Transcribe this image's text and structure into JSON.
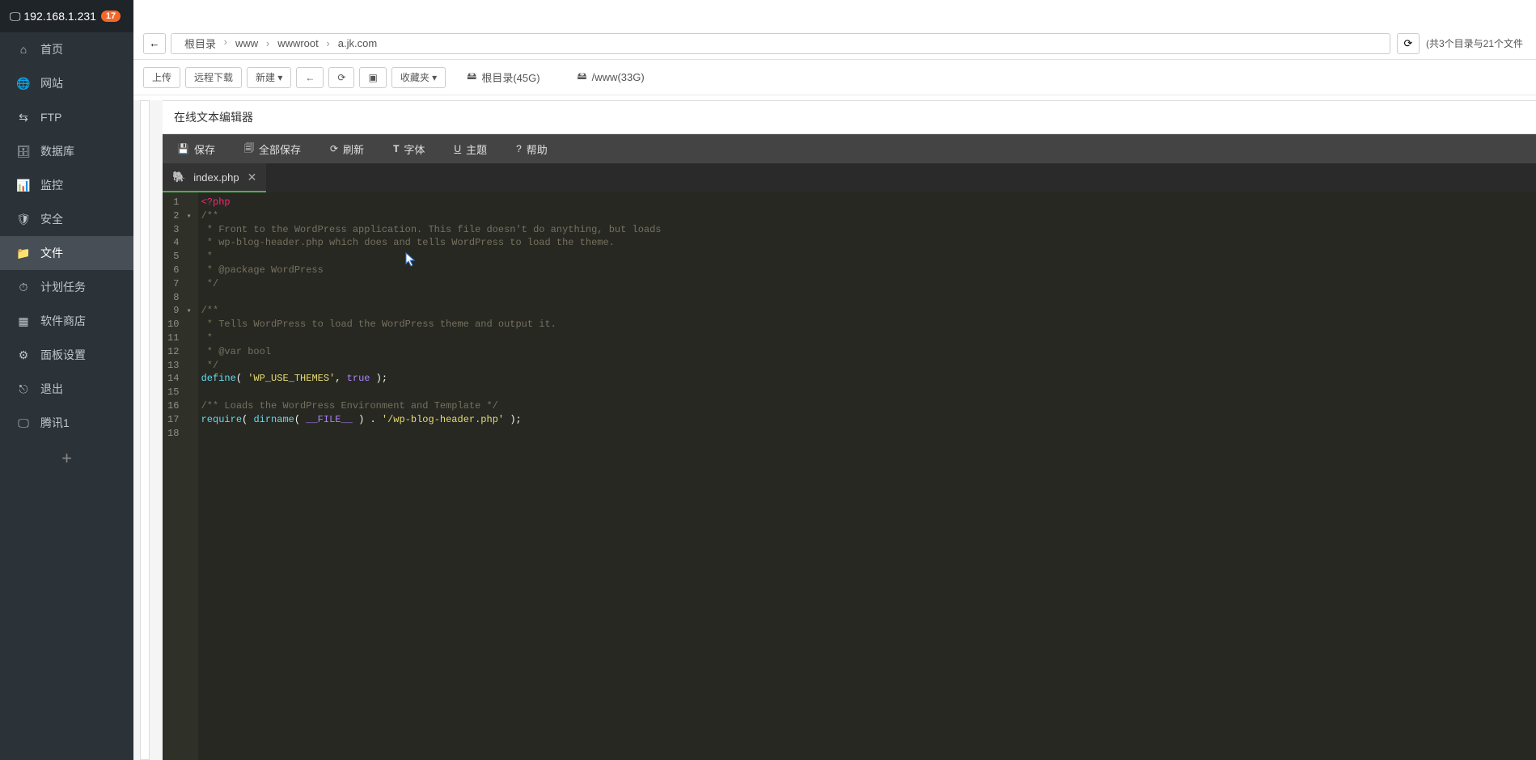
{
  "server": {
    "ip": "192.168.1.231",
    "badge": "17"
  },
  "sidebar": {
    "items": [
      {
        "label": "首页",
        "icon": "home"
      },
      {
        "label": "网站",
        "icon": "globe"
      },
      {
        "label": "FTP",
        "icon": "ftp"
      },
      {
        "label": "数据库",
        "icon": "db"
      },
      {
        "label": "监控",
        "icon": "monitor"
      },
      {
        "label": "安全",
        "icon": "shield"
      },
      {
        "label": "文件",
        "icon": "folder"
      },
      {
        "label": "计划任务",
        "icon": "cron"
      },
      {
        "label": "软件商店",
        "icon": "store"
      },
      {
        "label": "面板设置",
        "icon": "settings"
      },
      {
        "label": "退出",
        "icon": "logout"
      }
    ],
    "extra": {
      "label": "腾讯1"
    }
  },
  "breadcrumb": {
    "items": [
      "根目录",
      "www",
      "wwwroot",
      "a.jk.com"
    ],
    "count_text": "(共3个目录与21个文件"
  },
  "toolbar": {
    "upload": "上传",
    "remote_download": "远程下载",
    "new": "新建",
    "favorites": "收藏夹",
    "disks": [
      {
        "label": "根目录(45G)"
      },
      {
        "label": "/www(33G)"
      }
    ]
  },
  "editor": {
    "title": "在线文本编辑器",
    "buttons": {
      "save": "保存",
      "save_all": "全部保存",
      "refresh": "刷新",
      "font": "字体",
      "theme": "主题",
      "help": "帮助"
    },
    "tab": {
      "filename": "index.php"
    },
    "code_lines": [
      {
        "n": "1",
        "fold": "",
        "html": "<span class='c-tag'>&lt;?php</span>"
      },
      {
        "n": "2",
        "fold": "▾",
        "html": "<span class='c-comment'>/**</span>"
      },
      {
        "n": "3",
        "fold": "",
        "html": "<span class='c-comment'> * Front to the WordPress application. This file doesn't do anything, but loads</span>"
      },
      {
        "n": "4",
        "fold": "",
        "html": "<span class='c-comment'> * wp-blog-header.php which does and tells WordPress to load the theme.</span>"
      },
      {
        "n": "5",
        "fold": "",
        "html": "<span class='c-comment'> *</span>"
      },
      {
        "n": "6",
        "fold": "",
        "html": "<span class='c-comment'> * @package WordPress</span>"
      },
      {
        "n": "7",
        "fold": "",
        "html": "<span class='c-comment'> */</span>"
      },
      {
        "n": "8",
        "fold": "",
        "html": ""
      },
      {
        "n": "9",
        "fold": "▾",
        "html": "<span class='c-comment'>/**</span>"
      },
      {
        "n": "10",
        "fold": "",
        "html": "<span class='c-comment'> * Tells WordPress to load the WordPress theme and output it.</span>"
      },
      {
        "n": "11",
        "fold": "",
        "html": "<span class='c-comment'> *</span>"
      },
      {
        "n": "12",
        "fold": "",
        "html": "<span class='c-comment'> * @var bool</span>"
      },
      {
        "n": "13",
        "fold": "",
        "html": "<span class='c-comment'> */</span>"
      },
      {
        "n": "14",
        "fold": "",
        "html": "<span class='c-builtin'>define</span>( <span class='c-string'>'WP_USE_THEMES'</span>, <span class='c-const'>true</span> );"
      },
      {
        "n": "15",
        "fold": "",
        "html": ""
      },
      {
        "n": "16",
        "fold": "",
        "html": "<span class='c-comment'>/** Loads the WordPress Environment and Template */</span>"
      },
      {
        "n": "17",
        "fold": "",
        "html": "<span class='c-builtin'>require</span>( <span class='c-builtin'>dirname</span>( <span class='c-const'>__FILE__</span> ) . <span class='c-string'>'/wp-blog-header.php'</span> );"
      },
      {
        "n": "18",
        "fold": "",
        "html": ""
      }
    ]
  }
}
